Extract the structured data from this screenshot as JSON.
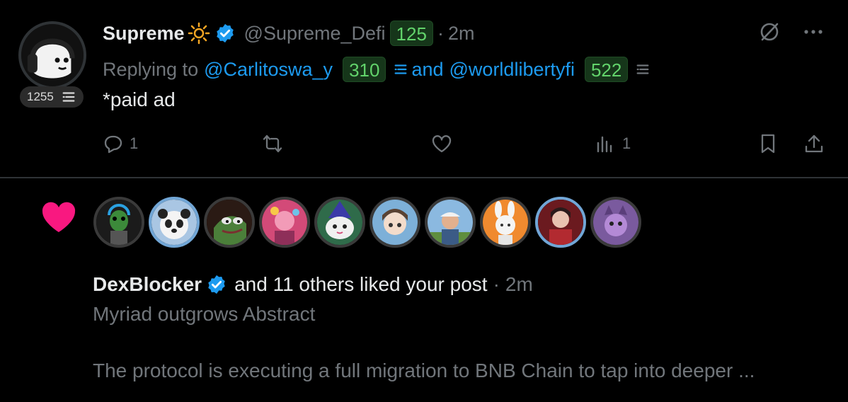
{
  "reply_post": {
    "author_name": "Supreme",
    "author_handle": "@Supreme_Defi",
    "author_score": "125",
    "separator": "·",
    "time": "2m",
    "avatar_score": "1255",
    "replying_to_label": "Replying to",
    "mention_1": "@Carlitoswa_y",
    "mention_1_score": "310",
    "and_label": "and",
    "mention_2": "@worldlibertyfi",
    "mention_2_score": "522",
    "text": "*paid ad",
    "reply_count": "1",
    "views_count": "1",
    "icons": [
      "sun-icon",
      "verified-icon",
      "list-icon",
      "grok-icon",
      "more-icon",
      "reply-icon",
      "retweet-icon",
      "like-icon",
      "views-icon",
      "bookmark-icon",
      "share-icon"
    ]
  },
  "like_notification": {
    "liker_name": "DexBlocker",
    "text": "and 11 others liked your post",
    "separator": "·",
    "time": "2m",
    "post_title": "Myriad outgrows Abstract",
    "post_excerpt": "The protocol is executing a full migration to BNB Chain to tap into deeper ...",
    "avatar_count": 10
  },
  "colors": {
    "background": "#000000",
    "accent": "#1d9bf0",
    "heart": "#f91880",
    "badge_green": "#62d36b",
    "muted": "#71767b"
  }
}
